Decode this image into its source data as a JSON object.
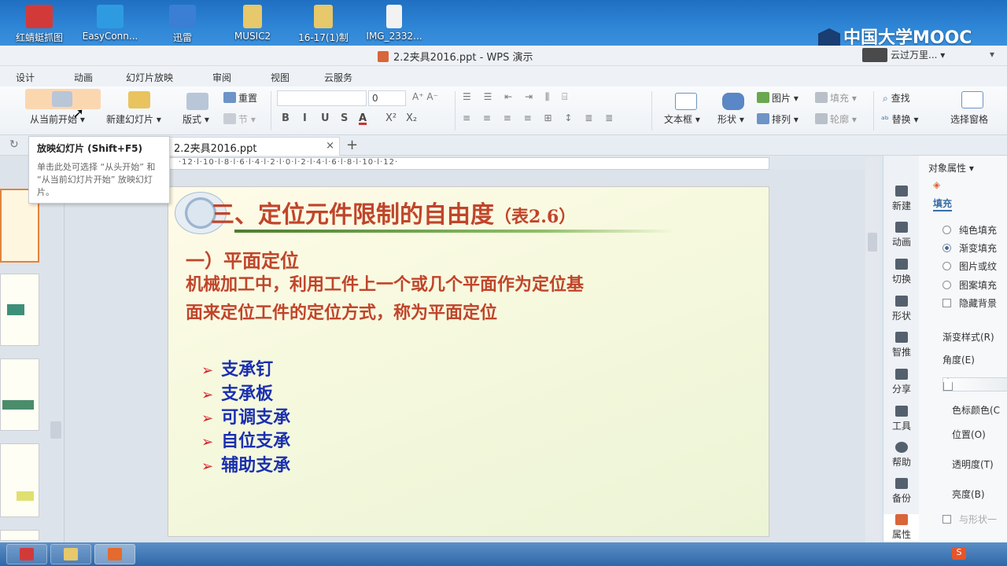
{
  "desktop": {
    "icons": [
      {
        "label": "红蜻蜓抓图",
        "color": "#d23a3a"
      },
      {
        "label": "EasyConn...",
        "color": "#2e9be0"
      },
      {
        "label": "迅雷",
        "color": "#3b7fd4"
      },
      {
        "label": "MUSIC2",
        "color": "#e7c86a"
      },
      {
        "label": "16-17(1)制",
        "color": "#e7c86a"
      },
      {
        "label": "IMG_2332...",
        "color": "#f2f2f2"
      }
    ],
    "watermark": "中国大学MOOC"
  },
  "window": {
    "title": "2.2夹具2016.ppt - WPS 演示",
    "user": "云过万里..."
  },
  "menu": [
    "设计",
    "动画",
    "幻灯片放映",
    "审阅",
    "视图",
    "云服务"
  ],
  "ribbon": {
    "from_current": "从当前开始",
    "new_slide": "新建幻灯片",
    "layout": "版式",
    "reset": "重置",
    "section": "节",
    "font_size": "0",
    "textbox": "文本框",
    "shape": "形状",
    "picture": "图片",
    "fill": "填充",
    "arrange": "排列",
    "outline": "轮廓",
    "find": "查找",
    "replace": "替换",
    "select_pane": "选择窗格",
    "fmt": [
      "B",
      "I",
      "U",
      "S",
      "A",
      "X²",
      "X₂"
    ]
  },
  "tooltip": {
    "title": "放映幻灯片 (Shift+F5)",
    "desc": "单击此处可选择 “从头开始” 和 “从当前幻灯片开始” 放映幻灯片。"
  },
  "doc_tab": {
    "name": "2.2夹具2016.ppt",
    "close": "×",
    "new": "+"
  },
  "ruler": "·12·l·10·l·8·l·6·l·4·l·2·l·0·l·2·l·4·l·6·l·8·l·10·l·12·",
  "slide": {
    "title": "三、定位元件限制的自由度",
    "title_suffix": "（表2.6）",
    "subheading": "一）平面定位",
    "body": [
      "机械加工中，利用工件上一个或几个平面作为定位基",
      "面来定位工件的定位方式，称为平面定位"
    ],
    "bullet_marker": "➢",
    "bullets": [
      "支承钉",
      "支承板",
      "可调支承",
      "自位支承",
      "辅助支承"
    ]
  },
  "side_icons": [
    "新建",
    "动画",
    "切换",
    "形状",
    "智推",
    "分享",
    "工具",
    "帮助",
    "备份",
    "属性"
  ],
  "props": {
    "header": "对象属性",
    "tab": "填充",
    "options": [
      "纯色填充",
      "渐变填充",
      "图片或纹",
      "图案填充"
    ],
    "selected_option": "渐变填充",
    "hide_bg": "隐藏背景",
    "gradient_style": "渐变样式(R)",
    "angle": "角度(E)",
    "stop_color": "色标颜色(C",
    "position": "位置(O)",
    "transparency": "透明度(T)",
    "brightness": "亮度(B)",
    "with_shape": "与形状一"
  }
}
